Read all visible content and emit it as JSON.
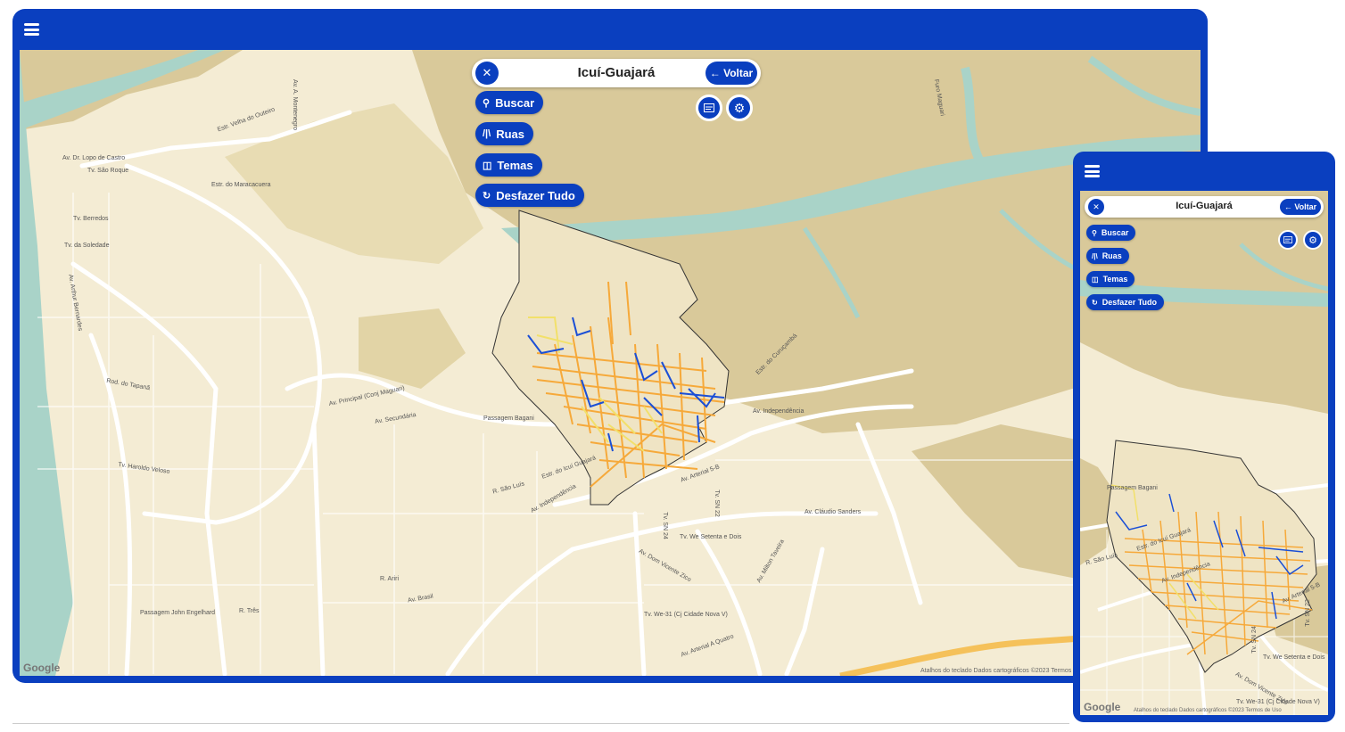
{
  "place": {
    "title": "Icuí-Guajará",
    "close_icon": "close-icon",
    "back_label": "Voltar"
  },
  "actions": [
    {
      "label": "Buscar",
      "icon": "search-icon"
    },
    {
      "label": "Ruas",
      "icon": "road-icon"
    },
    {
      "label": "Temas",
      "icon": "layers-icon"
    },
    {
      "label": "Desfazer Tudo",
      "icon": "undo-icon"
    }
  ],
  "map_labels": {
    "estr_velha_outeiro": "Estr. Velha do Outeiro",
    "av_montenegro": "Av. A. Montenegro",
    "av_lopo_castro": "Av. Dr. Lopo de Castro",
    "tv_sao_roque": "Tv. São Roque",
    "estr_maracacuera": "Estr. do Maracacuera",
    "tv_berredos": "Tv. Berredos",
    "tv_soledade": "Tv. da Soledade",
    "rod_tapana": "Rod. do Tapanã",
    "av_principal": "Av. Principal (Conj Maguari)",
    "av_secundaria": "Av. Secundária",
    "passagem_bagani": "Passagem Bagani",
    "av_independencia": "Av. Independência",
    "estr_curucamba": "Estr. do Curuçambá",
    "av_claudio_sanders": "Av. Cláudio Sanders",
    "tv_we_setenta": "Tv. We Setenta e Dois",
    "av_dom_vicente": "Av. Dom Vicente Zico",
    "av_milton_taveira": "Av. Milton Taveira",
    "tv_we31": "Tv. We-31 (Cj Cidade Nova V)",
    "av_arterial_5b": "Av. Arterial 5-B",
    "tv_sn24": "Tv. SN 24",
    "tv_sn22": "Tv. SN 22",
    "r_sao_luis": "R. São Luís",
    "estr_icui": "Estr. do Icuí Guajará",
    "tv_haroldo": "Tv. Haroldo Veloso",
    "passagem_john": "Passagem John Engelhard",
    "r_tres": "R. Três",
    "r_ariri": "R. Ariri",
    "av_brasil": "Av. Brasil",
    "av_arterial_a4": "Av. Arterial A Quatro",
    "furo_maguari": "Furo Maguari",
    "av_arthur_bernardes": "Av. Arthur Bernardes"
  },
  "google_label": "Google",
  "attribution": "Atalhos do teclado   Dados cartográficos ©2023   Termos de Uso",
  "colors": {
    "brand": "#0a3fbf",
    "land": "#f4ecd4",
    "river": "#a9d3c8",
    "dense": "#d9c99a",
    "orange": "#f6a93a",
    "yellow": "#f2e06a",
    "blue_line": "#1b4fd6"
  }
}
